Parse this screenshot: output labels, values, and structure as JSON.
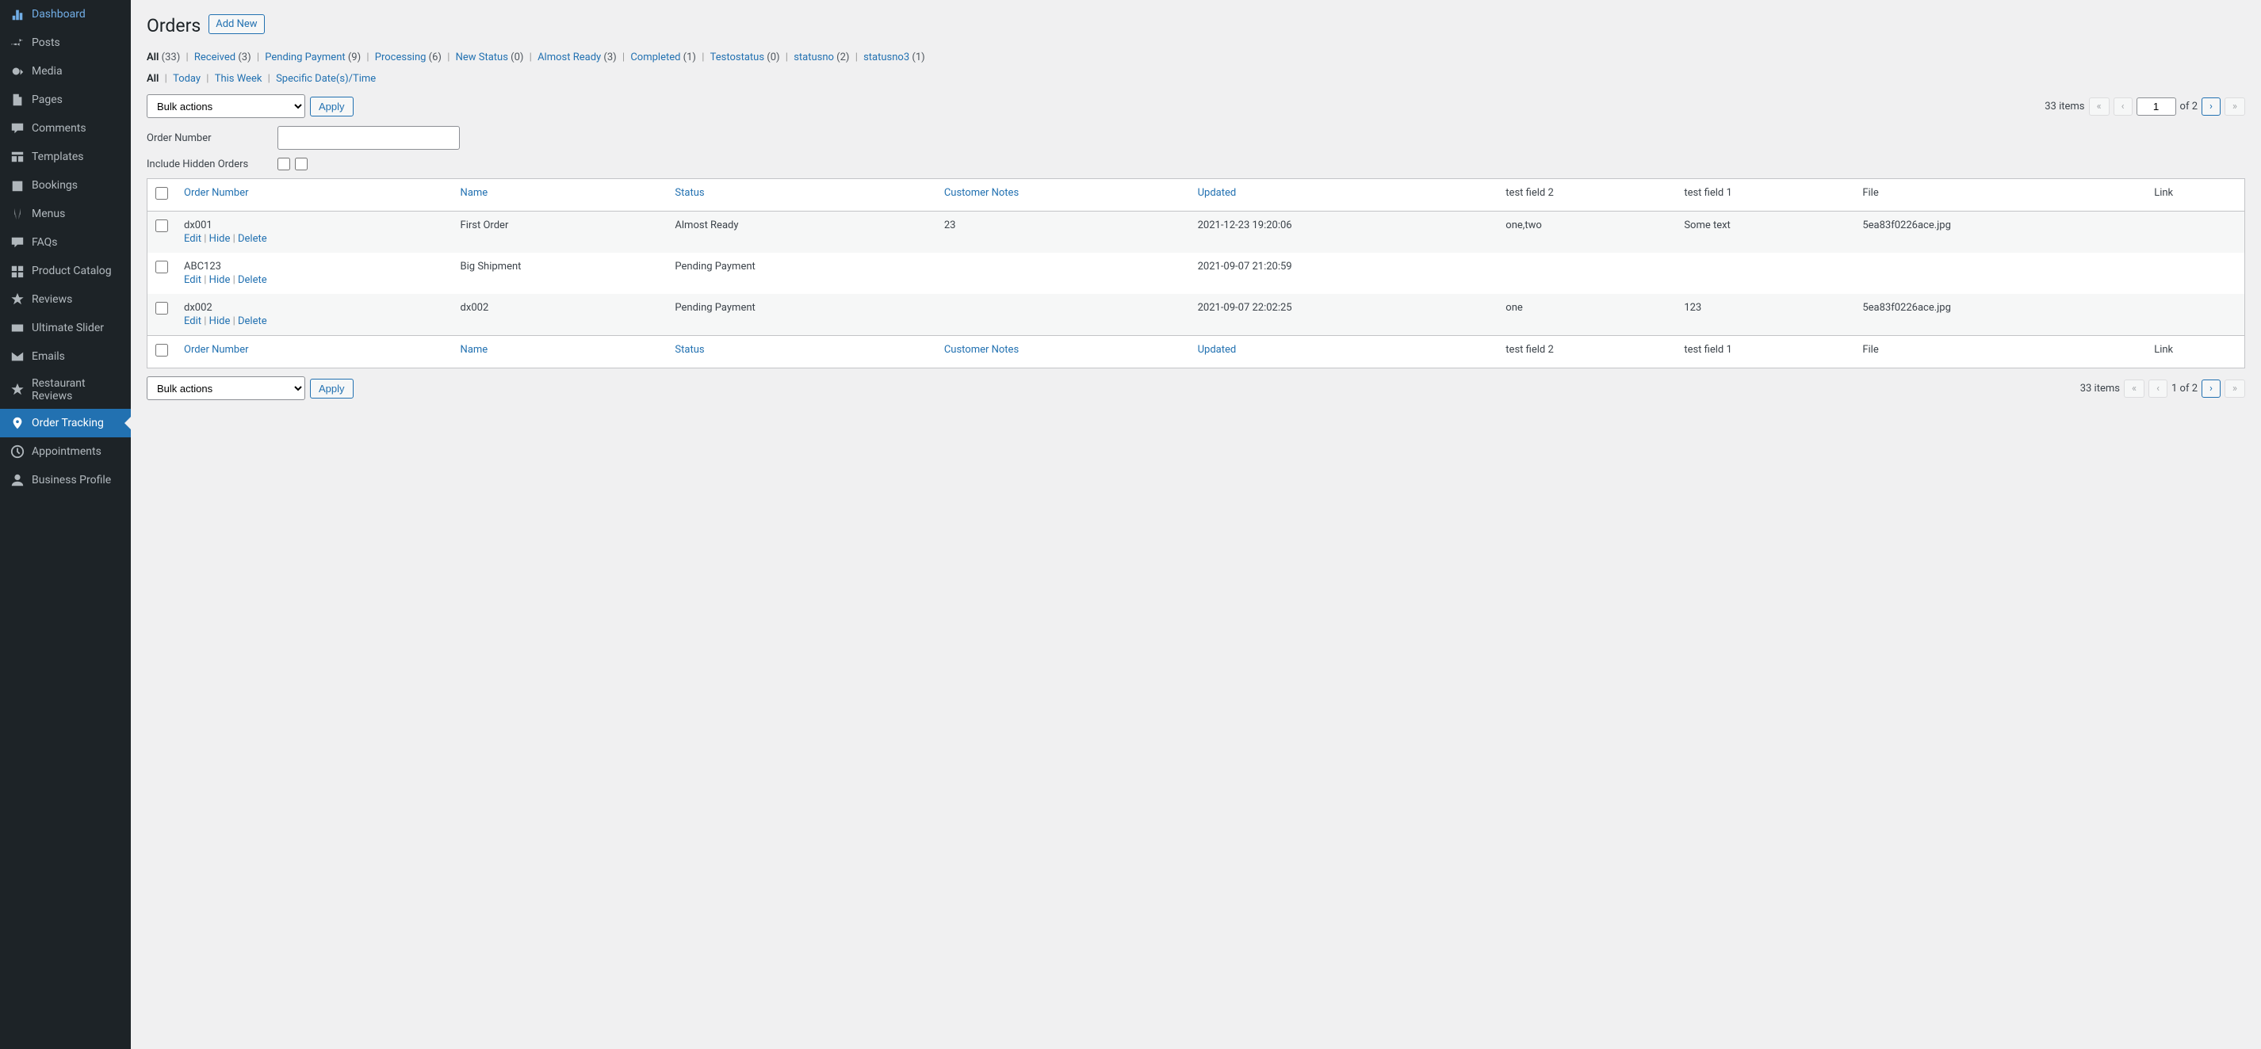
{
  "sidebar": {
    "items": [
      {
        "icon": "dashboard",
        "label": "Dashboard"
      },
      {
        "icon": "pin",
        "label": "Posts"
      },
      {
        "icon": "media",
        "label": "Media"
      },
      {
        "icon": "page",
        "label": "Pages"
      },
      {
        "icon": "comment",
        "label": "Comments"
      },
      {
        "icon": "layout",
        "label": "Templates"
      },
      {
        "icon": "calendar",
        "label": "Bookings"
      },
      {
        "icon": "menus",
        "label": "Menus"
      },
      {
        "icon": "faq",
        "label": "FAQs"
      },
      {
        "icon": "catalog",
        "label": "Product Catalog"
      },
      {
        "icon": "star",
        "label": "Reviews"
      },
      {
        "icon": "slider",
        "label": "Ultimate Slider"
      },
      {
        "icon": "mail",
        "label": "Emails"
      },
      {
        "icon": "star",
        "label": "Restaurant Reviews"
      },
      {
        "icon": "location",
        "label": "Order Tracking",
        "active": true
      },
      {
        "icon": "clock",
        "label": "Appointments"
      },
      {
        "icon": "user",
        "label": "Business Profile"
      }
    ]
  },
  "page": {
    "title": "Orders",
    "add_new": "Add New"
  },
  "status_filters": [
    {
      "label": "All",
      "count": "(33)",
      "current": true
    },
    {
      "label": "Received",
      "count": "(3)"
    },
    {
      "label": "Pending Payment",
      "count": "(9)"
    },
    {
      "label": "Processing",
      "count": "(6)"
    },
    {
      "label": "New Status",
      "count": "(0)"
    },
    {
      "label": "Almost Ready",
      "count": "(3)"
    },
    {
      "label": "Completed",
      "count": "(1)"
    },
    {
      "label": "Testostatus",
      "count": "(0)"
    },
    {
      "label": "statusno",
      "count": "(2)"
    },
    {
      "label": "statusno3",
      "count": "(1)"
    }
  ],
  "date_filters": [
    {
      "label": "All",
      "current": true
    },
    {
      "label": "Today"
    },
    {
      "label": "This Week"
    },
    {
      "label": "Specific Date(s)/Time"
    }
  ],
  "bulk": {
    "label": "Bulk actions",
    "apply": "Apply"
  },
  "pagination": {
    "items_text": "33 items",
    "page": "1",
    "of_text": "of 2",
    "simple_of": "1 of 2"
  },
  "search": {
    "order_number_label": "Order Number",
    "hidden_label": "Include Hidden Orders"
  },
  "columns": {
    "order_number": "Order Number",
    "name": "Name",
    "status": "Status",
    "customer_notes": "Customer Notes",
    "updated": "Updated",
    "tf2": "test field 2",
    "tf1": "test field 1",
    "file": "File",
    "link": "Link"
  },
  "row_actions": {
    "edit": "Edit",
    "hide": "Hide",
    "delete": "Delete"
  },
  "rows": [
    {
      "order_number": "dx001",
      "name": "First Order",
      "status": "Almost Ready",
      "notes": "23",
      "updated": "2021-12-23 19:20:06",
      "tf2": "one,two",
      "tf1": "Some text",
      "file": "5ea83f0226ace.jpg",
      "link": ""
    },
    {
      "order_number": "ABC123",
      "name": "Big Shipment",
      "status": "Pending Payment",
      "notes": "",
      "updated": "2021-09-07 21:20:59",
      "tf2": "",
      "tf1": "",
      "file": "",
      "link": ""
    },
    {
      "order_number": "dx002",
      "name": "dx002",
      "status": "Pending Payment",
      "notes": "",
      "updated": "2021-09-07 22:02:25",
      "tf2": "one",
      "tf1": "123",
      "file": "5ea83f0226ace.jpg",
      "link": ""
    }
  ]
}
